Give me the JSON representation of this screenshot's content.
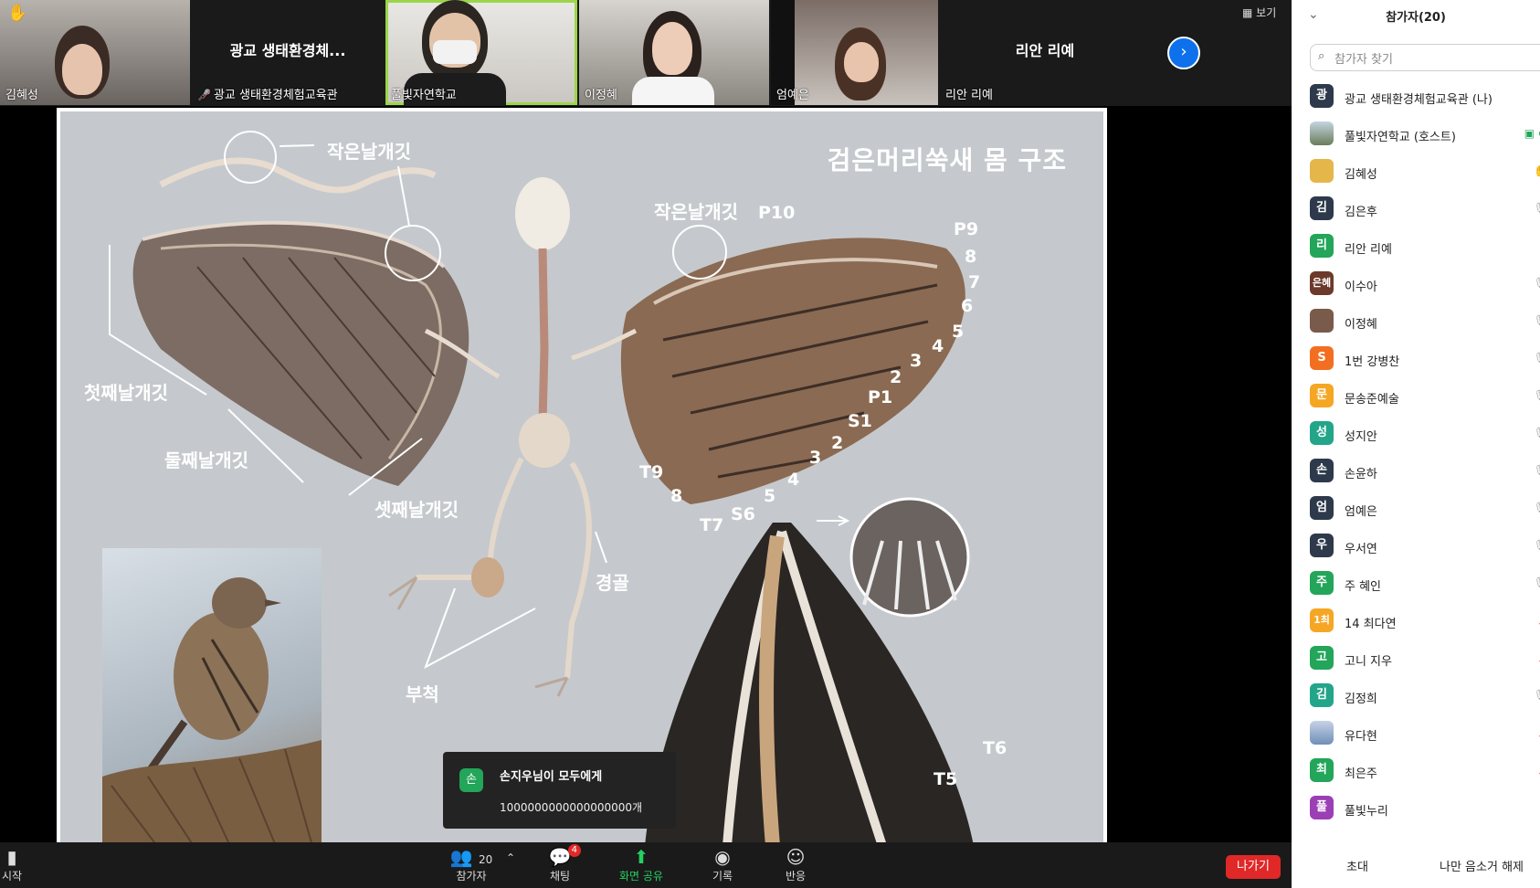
{
  "view_label": "보기",
  "tiles": [
    {
      "name": "김혜성"
    },
    {
      "center": "광교 생태환경체...",
      "name": "광교 생태환경체험교육관"
    },
    {
      "name": "풀빛자연학교"
    },
    {
      "name": "이정혜"
    },
    {
      "name": "엄예은"
    },
    {
      "center": "리안 리예",
      "name": "리안 리예"
    }
  ],
  "slide": {
    "title": "검은머리쑥새 몸 구조",
    "labels": {
      "small_coverts_left": "작은날개깃",
      "small_coverts_right": "작은날개깃",
      "primaries": "첫째날개깃",
      "secondaries": "둘째날개깃",
      "tertials": "셋째날개깃",
      "tibia": "경골",
      "tarsus": "부척"
    },
    "feather_numbers": {
      "p10": "P10",
      "p9": "P9",
      "n8": "8",
      "n7": "7",
      "n6": "6",
      "n5": "5",
      "n4": "4",
      "n3": "3",
      "n2": "2",
      "p1": "P1",
      "s1": "S1",
      "s2": "2",
      "s3": "3",
      "s4": "4",
      "s5": "5",
      "s6": "S6",
      "t7": "T7",
      "t8": "8",
      "t9": "T9",
      "t6": "T6",
      "t5": "T5"
    }
  },
  "chat_toast": {
    "avatar": "손",
    "from": "손지우님이 모두에게",
    "message": "1000000000000000000개"
  },
  "toolbar": {
    "start": "시작",
    "participants_label": "참가자",
    "participants_count": "20",
    "chat_label": "채팅",
    "chat_badge": "4",
    "share_label": "화면 공유",
    "record_label": "기록",
    "reactions_label": "반응",
    "leave_label": "나가기"
  },
  "panel": {
    "title": "참가자(20)",
    "search_placeholder": "참가자 찾기",
    "invite": "초대",
    "unmute_me": "나만 음소거 해제",
    "participants": [
      {
        "avatar": "광",
        "color": "#2e3a4b",
        "name": "광교 생태환경체험교육관 (나)"
      },
      {
        "avatar": "",
        "color": "#8ca07a",
        "name": "풀빛자연학교 (호스트)"
      },
      {
        "avatar": "",
        "color": "#e5b64a",
        "name": "김혜성"
      },
      {
        "avatar": "김",
        "color": "#2e3a4b",
        "name": "김은후"
      },
      {
        "avatar": "리",
        "color": "#23a55a",
        "name": "리안 리예"
      },
      {
        "avatar": "은혜",
        "color": "#6b3a2a",
        "name": "이수아"
      },
      {
        "avatar": "",
        "color": "#7a5a4a",
        "name": "이정혜"
      },
      {
        "avatar": "S",
        "color": "#f26f21",
        "name": "1번 강병찬"
      },
      {
        "avatar": "문",
        "color": "#f5a623",
        "name": "문송준예술"
      },
      {
        "avatar": "성",
        "color": "#23a58a",
        "name": "성지안"
      },
      {
        "avatar": "손",
        "color": "#2e3a4b",
        "name": "손윤하"
      },
      {
        "avatar": "엄",
        "color": "#2e3a4b",
        "name": "엄예은"
      },
      {
        "avatar": "우",
        "color": "#2e3a4b",
        "name": "우서연"
      },
      {
        "avatar": "주",
        "color": "#23a55a",
        "name": "주 혜인"
      },
      {
        "avatar": "1최",
        "color": "#f5a623",
        "name": "14 최다연"
      },
      {
        "avatar": "고",
        "color": "#23a55a",
        "name": "고니 지우"
      },
      {
        "avatar": "김",
        "color": "#23a58a",
        "name": "김정희"
      },
      {
        "avatar": "",
        "color": "#6e8fb8",
        "name": "유다현"
      },
      {
        "avatar": "최",
        "color": "#23a55a",
        "name": "최은주"
      },
      {
        "avatar": "풀",
        "color": "#9b3fb5",
        "name": "풀빛누리"
      }
    ]
  }
}
